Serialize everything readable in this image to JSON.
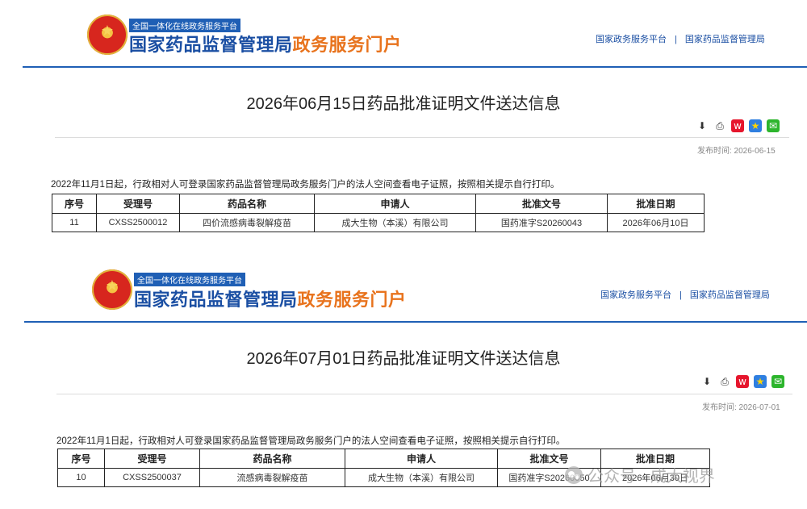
{
  "portal": {
    "badge": "全国一体化在线政务服务平台",
    "title_blue": "国家药品监督管理局",
    "title_orange": "政务服务门户",
    "links": [
      "国家政务服务平台",
      "国家药品监督管理局"
    ],
    "separator": "|"
  },
  "notices": [
    {
      "title": "2026年06月15日药品批准证明文件送达信息",
      "pub_date": "发布时间: 2026-06-15",
      "notice": "2022年11月1日起，行政相对人可登录国家药品监督管理局政务服务门户的法人空间查看电子证照，按照相关提示自行打印。",
      "headers": [
        "序号",
        "受理号",
        "药品名称",
        "申请人",
        "批准文号",
        "批准日期"
      ],
      "row": [
        "11",
        "CXSS2500012",
        "四价流感病毒裂解疫苗",
        "成大生物（本溪）有限公司",
        "国药准字S20260043",
        "2026年06月10日"
      ]
    },
    {
      "title": "2026年07月01日药品批准证明文件送达信息",
      "pub_date": "发布时间: 2026-07-01",
      "notice": "2022年11月1日起，行政相对人可登录国家药品监督管理局政务服务门户的法人空间查看电子证照，按照相关提示自行打印。",
      "headers": [
        "序号",
        "受理号",
        "药品名称",
        "申请人",
        "批准文号",
        "批准日期"
      ],
      "row": [
        "10",
        "CXSS2500037",
        "流感病毒裂解疫苗",
        "成大生物（本溪）有限公司",
        "国药准字S20260050",
        "2026年06月30日"
      ]
    }
  ],
  "tool_icons": [
    "download-icon",
    "print-icon",
    "weibo-icon",
    "favorite-star-icon",
    "wechat-icon"
  ],
  "watermark": "公众号 · 成大视界",
  "colors": {
    "brand_blue": "#1b4fa3",
    "brand_orange": "#e8731d",
    "rule_blue": "#1f5fb5"
  }
}
